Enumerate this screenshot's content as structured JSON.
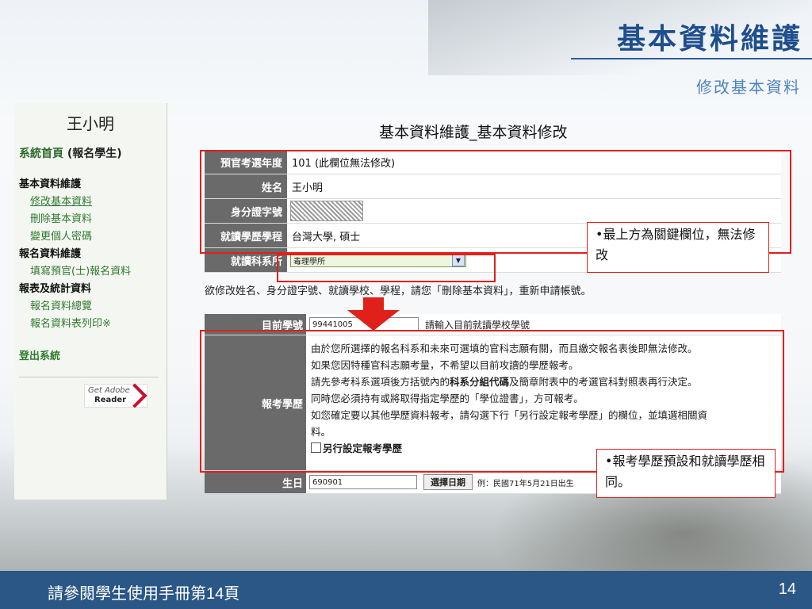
{
  "header": {
    "title": "基本資料維護",
    "subtitle": "修改基本資料"
  },
  "sidebar": {
    "user_name": "王小明",
    "home_link": "系統首頁",
    "home_suffix": "(報名學生)",
    "section1": "基本資料維護",
    "items1": [
      "修改基本資料",
      "刪除基本資料",
      "變更個人密碼"
    ],
    "section2": "報名資料維護",
    "items2": [
      "填寫預官(士)報名資料"
    ],
    "section3": "報表及統計資料",
    "items3": [
      "報名資料總覽",
      "報名資料表列印※"
    ],
    "logout": "登出系統",
    "reader_badge": {
      "line1": "Get Adobe",
      "line2": "Reader"
    }
  },
  "main": {
    "title": "基本資料維護_基本資料修改",
    "fields": {
      "year": {
        "label": "預官考選年度",
        "value": "101 (此欄位無法修改)"
      },
      "name": {
        "label": "姓名",
        "value": "王小明"
      },
      "id": {
        "label": "身分證字號"
      },
      "program": {
        "label": "就讀學歷學程",
        "value": "台灣大學, 碩士"
      },
      "dept": {
        "label": "就讀科系所",
        "selected": "毒理學所"
      }
    },
    "note": "欲修改姓名、身分證字號、就讀學校、學程，請您「刪除基本資料」，重新申請帳號。",
    "student_no": {
      "label": "目前學號",
      "value": "99441005",
      "hint": "請輸入目前就讀學校學號"
    },
    "exam_edu": {
      "label": "報考學歷",
      "line1": "由於您所選擇的報名科系和未來可選填的官科志願有關，而且繳交報名表後即無法修改。",
      "line2": "如果您因特種官科志願考量，不希望以目前攻讀的學歷報考。",
      "line3a": "請先參考科系選項後方括號內的",
      "line3b": "科系分組代碼",
      "line3c": "及簡章附表中的考選官科對照表再行決定。",
      "line4": "同時您必須持有或將取得指定學歷的「學位證書」，方可報考。",
      "line5": "如您確定要以其他學歷資料報考，請勾選下行「另行設定報考學歷」的欄位，並填選相關資",
      "line6": "料。",
      "checkbox_label": "另行設定報考學歷"
    },
    "birth": {
      "label": "生日",
      "value": "690901",
      "button": "選擇日期",
      "example": "例：民國71年5月21日出生"
    }
  },
  "callouts": {
    "top": "•最上方為關鍵欄位，無法修改",
    "bottom": "•報考學歷預設和就讀學歷相同。"
  },
  "footer": {
    "reference": "請參閱學生使用手冊第14頁",
    "page": "14"
  },
  "colors": {
    "header_title": "#1f4e8c",
    "label_bg": "#6a6a6a",
    "callout_red": "#e0201a",
    "footer_bg": "#2a5786",
    "sidebar_link": "#2f7a2f"
  }
}
